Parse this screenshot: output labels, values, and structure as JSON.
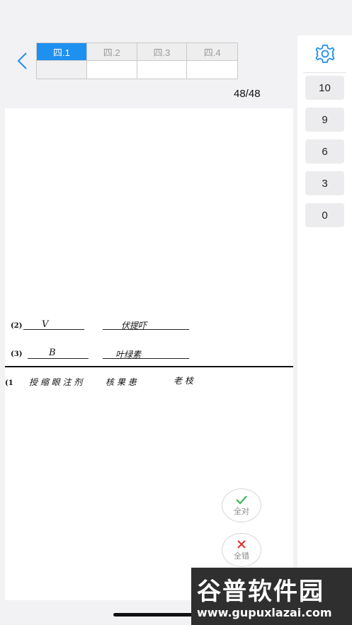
{
  "tabs": [
    {
      "label": "四.1",
      "active": true
    },
    {
      "label": "四.2",
      "active": false
    },
    {
      "label": "四.3",
      "active": false
    },
    {
      "label": "四.4",
      "active": false
    }
  ],
  "progress": "48/48",
  "scores": [
    "10",
    "9",
    "6",
    "3",
    "0"
  ],
  "answers": {
    "q2_label": "(2)",
    "q2_a1": "V",
    "q2_a2": "伏提吓",
    "q3_label": "(3)",
    "q3_a1": "B",
    "q3_a2": "叶绿素",
    "next_label": "(1",
    "next_a1": "授 缩 眼 注 剂",
    "next_a2": "核 果 患",
    "next_a3": "老 枝"
  },
  "actions": {
    "all_correct": "全对",
    "all_wrong": "全错"
  },
  "watermark": {
    "brand": "谷普软件园",
    "url": "www.gupuxlazai.com"
  },
  "colors": {
    "accent": "#1e90f0",
    "correct": "#2db34a",
    "wrong": "#e0302c"
  }
}
